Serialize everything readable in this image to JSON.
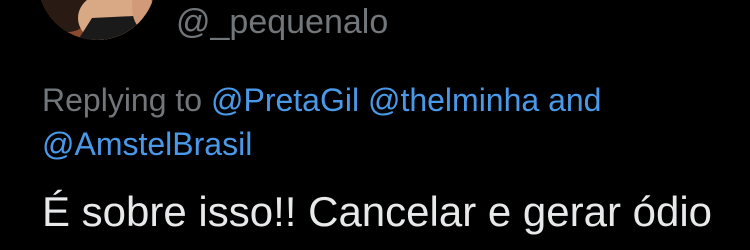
{
  "tweet": {
    "handle": "@_pequenalo",
    "replying_prefix": "Replying to",
    "mentions": [
      "@PretaGil",
      "@thelminha",
      "@AmstelBrasil"
    ],
    "conjunction": "and",
    "text": "É sobre isso!! Cancelar e gerar ódio"
  },
  "colors": {
    "background": "#000000",
    "secondary_text": "#71767b",
    "mention": "#4a99e9",
    "primary_text": "#e7e9ea"
  },
  "icons": {
    "avatar": "profile-photo"
  }
}
